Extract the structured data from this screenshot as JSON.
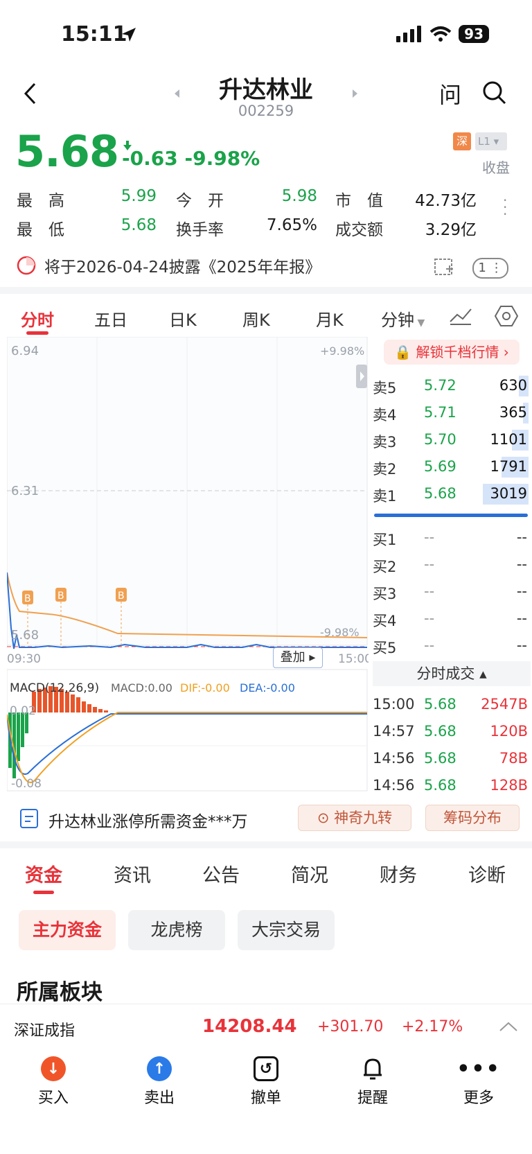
{
  "status_bar": {
    "time": "15:11",
    "battery": "93"
  },
  "header": {
    "title": "升达林业",
    "code": "002259",
    "ask_label": "问"
  },
  "quote": {
    "price": "5.68",
    "change": "-0.63",
    "change_pct": "-9.98%",
    "exchange_tag": "深",
    "level_tag": "L1",
    "status": "收盘",
    "high_label": "最　高",
    "high": "5.99",
    "open_label": "今　开",
    "open": "5.98",
    "mcap_label": "市　值",
    "mcap": "42.73亿",
    "low_label": "最　低",
    "low": "5.68",
    "turnover_label": "换手率",
    "turnover": "7.65%",
    "amount_label": "成交额",
    "amount": "3.29亿"
  },
  "disclosure": {
    "text": "将于2026-04-24披露《2025年年报》",
    "badge": "1"
  },
  "chart_tabs": [
    "分时",
    "五日",
    "日K",
    "周K",
    "月K",
    "分钟"
  ],
  "intraday": {
    "y_top": "6.94",
    "y_mid": "6.31",
    "y_bottom": "5.68",
    "pct_top": "+9.98%",
    "pct_bottom": "-9.98%",
    "t_start": "09:30",
    "t_end": "15:00",
    "overlay_btn": "叠加",
    "marker": "B"
  },
  "macd": {
    "title": "MACD(12,26,9)",
    "macd": "MACD:0.00",
    "dif": "DIF:-0.00",
    "dea": "DEA:-0.00",
    "y_top": "0.02",
    "y_bottom": "-0.08"
  },
  "order_book": {
    "unlock": "解锁千档行情",
    "asks": [
      {
        "label": "卖5",
        "price": "5.72",
        "vol": "630"
      },
      {
        "label": "卖4",
        "price": "5.71",
        "vol": "365"
      },
      {
        "label": "卖3",
        "price": "5.70",
        "vol": "1101"
      },
      {
        "label": "卖2",
        "price": "5.69",
        "vol": "1791"
      },
      {
        "label": "卖1",
        "price": "5.68",
        "vol": "3019"
      }
    ],
    "bids": [
      {
        "label": "买1",
        "price": "--",
        "vol": "--"
      },
      {
        "label": "买2",
        "price": "--",
        "vol": "--"
      },
      {
        "label": "买3",
        "price": "--",
        "vol": "--"
      },
      {
        "label": "买4",
        "price": "--",
        "vol": "--"
      },
      {
        "label": "买5",
        "price": "--",
        "vol": "--"
      }
    ]
  },
  "trades": {
    "title": "分时成交",
    "rows": [
      {
        "time": "15:00",
        "price": "5.68",
        "vol": "2547B"
      },
      {
        "time": "14:57",
        "price": "5.68",
        "vol": "120B"
      },
      {
        "time": "14:56",
        "price": "5.68",
        "vol": "78B"
      },
      {
        "time": "14:56",
        "price": "5.68",
        "vol": "128B"
      }
    ]
  },
  "promo": {
    "text": "升达林业涨停所需资金***万",
    "btn1": "神奇九转",
    "btn2": "筹码分布"
  },
  "section_tabs": [
    "资金",
    "资讯",
    "公告",
    "简况",
    "财务",
    "诊断"
  ],
  "pills": [
    "主力资金",
    "龙虎榜",
    "大宗交易"
  ],
  "sector": {
    "heading": "所属板块",
    "index_name": "深证成指",
    "index_value": "14208.44",
    "index_change": "+301.70",
    "index_pct": "+2.17%"
  },
  "bottom_nav": [
    "买入",
    "卖出",
    "撤单",
    "提醒",
    "更多"
  ]
}
